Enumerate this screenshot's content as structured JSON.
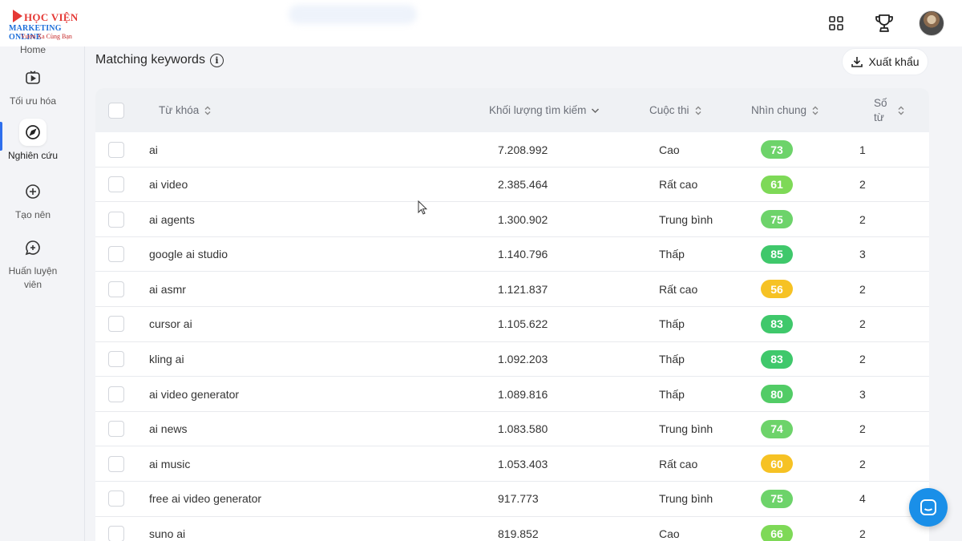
{
  "logo": {
    "line1": "HỌC VIỆN",
    "line2": "MARKETING ONLINE",
    "line3": "Vươn Xa Cùng Bạn"
  },
  "sidebar": {
    "items": [
      {
        "label": "Home",
        "icon": "home-icon"
      },
      {
        "label": "Tối ưu hóa",
        "icon": "youtube-icon"
      },
      {
        "label": "Nghiên cứu",
        "icon": "compass-icon",
        "active": true
      },
      {
        "label": "Tạo nên",
        "icon": "plus-circle-icon"
      },
      {
        "label": "Huấn luyện\nviên",
        "icon": "chat-bubble-icon"
      }
    ]
  },
  "header": {
    "icons": [
      "apps-grid-icon",
      "trophy-icon",
      "avatar"
    ]
  },
  "main": {
    "title": "Matching keywords",
    "export_label": "Xuất khẩu",
    "columns": {
      "keyword": "Từ khóa",
      "volume": "Khối lượng tìm kiếm",
      "competition": "Cuộc thi",
      "overall": "Nhìn chung",
      "word_count": "Số\ntừ"
    },
    "rows": [
      {
        "keyword": "ai",
        "volume": "7.208.992",
        "competition": "Cao",
        "score": "73",
        "score_color": "#6dd36a",
        "words": "1"
      },
      {
        "keyword": "ai video",
        "volume": "2.385.464",
        "competition": "Rất cao",
        "score": "61",
        "score_color": "#7ed957",
        "words": "2"
      },
      {
        "keyword": "ai agents",
        "volume": "1.300.902",
        "competition": "Trung bình",
        "score": "75",
        "score_color": "#6dd36a",
        "words": "2"
      },
      {
        "keyword": "google ai studio",
        "volume": "1.140.796",
        "competition": "Thấp",
        "score": "85",
        "score_color": "#3fc86b",
        "words": "3"
      },
      {
        "keyword": "ai asmr",
        "volume": "1.121.837",
        "competition": "Rất cao",
        "score": "56",
        "score_color": "#f6c224",
        "words": "2"
      },
      {
        "keyword": "cursor ai",
        "volume": "1.105.622",
        "competition": "Thấp",
        "score": "83",
        "score_color": "#3fc86b",
        "words": "2"
      },
      {
        "keyword": "kling ai",
        "volume": "1.092.203",
        "competition": "Thấp",
        "score": "83",
        "score_color": "#3fc86b",
        "words": "2"
      },
      {
        "keyword": "ai video generator",
        "volume": "1.089.816",
        "competition": "Thấp",
        "score": "80",
        "score_color": "#52cc66",
        "words": "3"
      },
      {
        "keyword": "ai news",
        "volume": "1.083.580",
        "competition": "Trung bình",
        "score": "74",
        "score_color": "#6dd36a",
        "words": "2"
      },
      {
        "keyword": "ai music",
        "volume": "1.053.403",
        "competition": "Rất cao",
        "score": "60",
        "score_color": "#f6c224",
        "words": "2"
      },
      {
        "keyword": "free ai video generator",
        "volume": "917.773",
        "competition": "Trung bình",
        "score": "75",
        "score_color": "#6dd36a",
        "words": "4"
      },
      {
        "keyword": "suno ai",
        "volume": "819.852",
        "competition": "Cao",
        "score": "66",
        "score_color": "#7ed957",
        "words": "2"
      }
    ]
  }
}
